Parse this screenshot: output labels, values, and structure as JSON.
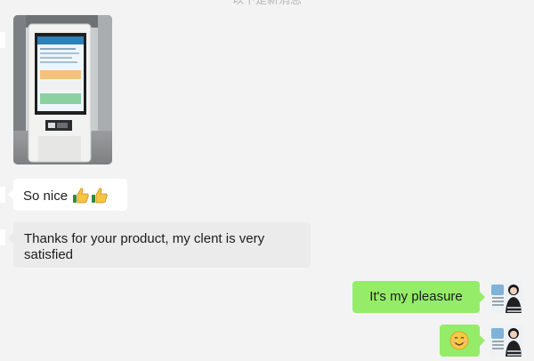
{
  "chat": {
    "top_partial_text": "以下是新消息",
    "messages": [
      {
        "sender": "contact",
        "type": "image",
        "image_icon": "kiosk-photo"
      },
      {
        "sender": "contact",
        "type": "text",
        "text": "So nice",
        "emojis": [
          "thumbs-up-icon",
          "thumbs-up-icon"
        ]
      },
      {
        "sender": "contact",
        "type": "text",
        "text": "Thanks for your product, my clent is very satisfied"
      },
      {
        "sender": "self",
        "type": "text",
        "text": "It's my pleasure"
      },
      {
        "sender": "self",
        "type": "emoji",
        "emoji": "smiling-face-icon"
      }
    ]
  },
  "colors": {
    "background": "#f3f3f3",
    "incoming_bubble": "#ffffff",
    "incoming_bubble_alt": "#ebebeb",
    "outgoing_bubble": "#95ec69"
  }
}
